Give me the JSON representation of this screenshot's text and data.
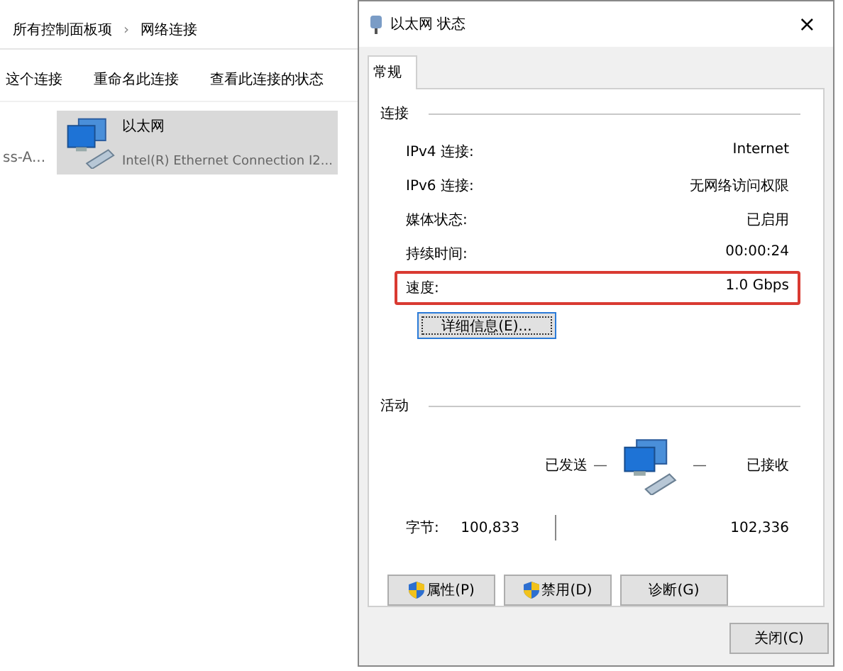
{
  "explorer": {
    "breadcrumb": [
      "所有控制面板项",
      "网络连接"
    ],
    "breadcrumb_separator": "›",
    "toolbar": [
      "这个连接",
      "重命名此连接",
      "查看此连接的状态"
    ],
    "items": [
      {
        "kind": "partial",
        "name": "ss-A..."
      },
      {
        "kind": "adapter",
        "name": "以太网",
        "device": "Intel(R) Ethernet Connection I2...",
        "selected": true
      }
    ]
  },
  "dialog": {
    "title": "以太网 状态",
    "close": "×",
    "tabs": [
      {
        "label": "常规",
        "selected": true
      }
    ],
    "connection": {
      "heading": "连接",
      "rows": [
        {
          "label": "IPv4 连接:",
          "value": "Internet",
          "highlighted": false
        },
        {
          "label": "IPv6 连接:",
          "value": "无网络访问权限",
          "highlighted": false
        },
        {
          "label": "媒体状态:",
          "value": "已启用",
          "highlighted": false
        },
        {
          "label": "持续时间:",
          "value": "00:00:24",
          "highlighted": false
        },
        {
          "label": "速度:",
          "value": "1.0 Gbps",
          "highlighted": true
        }
      ],
      "details_button": "详细信息(E)..."
    },
    "activity": {
      "heading": "活动",
      "sent_label": "已发送",
      "received_label": "已接收",
      "dash": "—",
      "bytes_label": "字节:",
      "bytes_sent": "100,833",
      "bytes_received": "102,336"
    },
    "buttons": [
      {
        "label": "属性(P)",
        "shield": true
      },
      {
        "label": "禁用(D)",
        "shield": true
      },
      {
        "label": "诊断(G)",
        "shield": false
      }
    ],
    "close_button": "关闭(C)"
  }
}
